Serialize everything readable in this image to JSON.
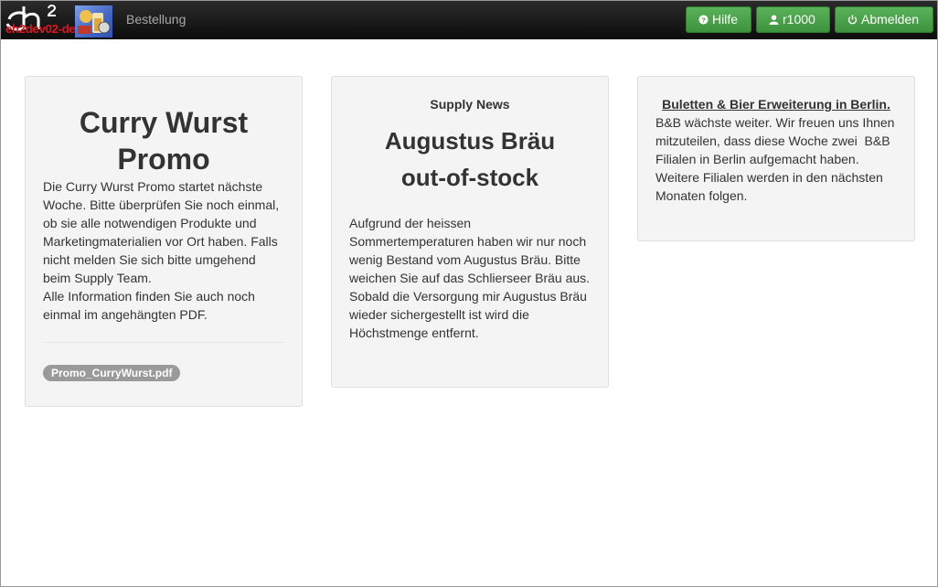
{
  "header": {
    "environment": "eh2dev02-dev",
    "brand": "Bestellung",
    "help_label": "Hilfe",
    "user_label": "r1000",
    "logout_label": "Abmelden"
  },
  "colors": {
    "navbar": "#1a1a1a",
    "button_green": "#4cae4c",
    "environment_red": "#e8121e"
  },
  "icons": {
    "help": "question-circle-icon",
    "user": "user-icon",
    "logout": "power-icon"
  },
  "cards": [
    {
      "title_line1": "Curry Wurst",
      "title_line2": "Promo",
      "paragraphs": [
        "Die Curry Wurst Promo startet nächste Woche. Bitte überprüfen Sie noch einmal, ob sie alle notwendigen Produkte und Marketingmaterialien vor Ort haben. Falls nicht melden Sie sich bitte umgehend beim Supply Team.",
        "Alle Information finden Sie auch noch einmal im angehängten PDF."
      ],
      "attachment": "Promo_CurryWurst.pdf"
    },
    {
      "kicker": "Supply News",
      "title_line1": "Augustus Bräu",
      "title_line2": "out-of-stock",
      "paragraphs": [
        "Aufgrund der heissen Sommertemperaturen haben wir nur noch wenig Bestand vom Augustus Bräu. Bitte weichen Sie auf das Schlierseer Bräu aus.",
        "Sobald die Versorgung mir Augustus Bräu wieder sichergestellt ist wird die Höchstmenge entfernt."
      ]
    },
    {
      "heading": "Buletten & Bier Erweiterung in Berlin.",
      "paragraphs": [
        "B&B wächste weiter. Wir freuen uns Ihnen mitzuteilen, dass diese Woche zwei  B&B Filialen in Berlin aufgemacht haben.",
        "Weitere Filialen werden in den nächsten Monaten folgen."
      ]
    }
  ]
}
